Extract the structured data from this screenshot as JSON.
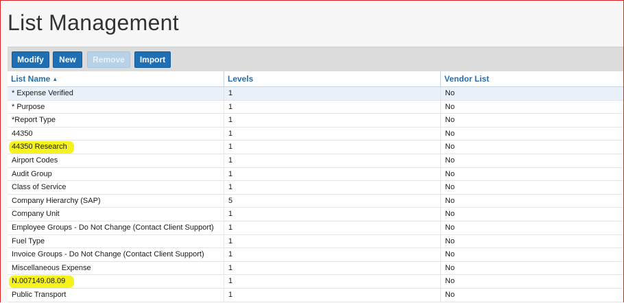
{
  "page": {
    "title": "List Management"
  },
  "toolbar": {
    "buttons": [
      {
        "label": "Modify",
        "enabled": true
      },
      {
        "label": "New",
        "enabled": true
      },
      {
        "label": "Remove",
        "enabled": false
      },
      {
        "label": "Import",
        "enabled": true
      }
    ]
  },
  "table": {
    "columns": [
      {
        "label": "List Name",
        "sort": "ascending"
      },
      {
        "label": "Levels"
      },
      {
        "label": "Vendor List"
      }
    ],
    "rows": [
      {
        "name": "* Expense Verified",
        "levels": "1",
        "vendor": "No",
        "selected": true
      },
      {
        "name": "* Purpose",
        "levels": "1",
        "vendor": "No"
      },
      {
        "name": "*Report Type",
        "levels": "1",
        "vendor": "No"
      },
      {
        "name": "44350",
        "levels": "1",
        "vendor": "No"
      },
      {
        "name": "44350 Research",
        "levels": "1",
        "vendor": "No",
        "highlighted": true
      },
      {
        "name": "Airport Codes",
        "levels": "1",
        "vendor": "No"
      },
      {
        "name": "Audit Group",
        "levels": "1",
        "vendor": "No"
      },
      {
        "name": "Class of Service",
        "levels": "1",
        "vendor": "No"
      },
      {
        "name": "Company Hierarchy (SAP)",
        "levels": "5",
        "vendor": "No"
      },
      {
        "name": "Company Unit",
        "levels": "1",
        "vendor": "No"
      },
      {
        "name": "Employee Groups - Do Not Change (Contact Client Support)",
        "levels": "1",
        "vendor": "No"
      },
      {
        "name": "Fuel Type",
        "levels": "1",
        "vendor": "No"
      },
      {
        "name": "Invoice Groups - Do Not Change (Contact Client Support)",
        "levels": "1",
        "vendor": "No"
      },
      {
        "name": "Miscellaneous Expense",
        "levels": "1",
        "vendor": "No"
      },
      {
        "name": "N.007149.08.09",
        "levels": "1",
        "vendor": "No",
        "highlighted": true
      },
      {
        "name": "Public Transport",
        "levels": "1",
        "vendor": "No"
      }
    ]
  },
  "colors": {
    "accent": "#1f6fb4",
    "highlight": "#f4f10a",
    "selected_row": "#e9f2fb",
    "toolbar_bg": "#dcdcdc",
    "frame_border": "#d9201f"
  },
  "icons": {
    "sort": "sort-ascending-icon"
  }
}
